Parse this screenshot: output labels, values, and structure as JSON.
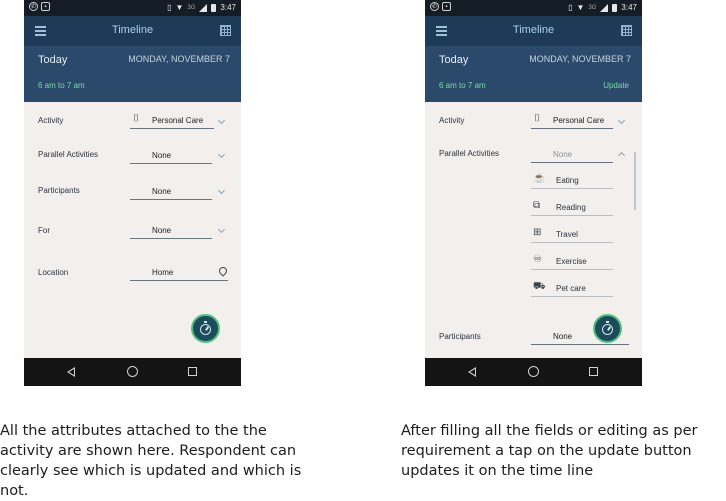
{
  "status_bar": {
    "time": "3:47",
    "network": "3G"
  },
  "left_screen": {
    "app_title": "Timeline",
    "today_label": "Today",
    "date": "MONDAY, NOVEMBER 7",
    "time_range": "6 am to 7 am",
    "rows": [
      {
        "label": "Activity",
        "value": "Personal Care"
      },
      {
        "label": "Parallel Activities",
        "value": "None"
      },
      {
        "label": "Participants",
        "value": "None"
      },
      {
        "label": "For",
        "value": "None"
      },
      {
        "label": "Location",
        "value": "Home"
      }
    ]
  },
  "right_screen": {
    "app_title": "Timeline",
    "today_label": "Today",
    "date": "MONDAY, NOVEMBER 7",
    "time_range": "6 am to 7 am",
    "update_label": "Update",
    "activity_label": "Activity",
    "activity_value": "Personal Care",
    "parallel_label": "Parallel Activities",
    "parallel_value": "None",
    "suggestions": [
      "Eating",
      "Reading",
      "Travel",
      "Exercise",
      "Pet care"
    ],
    "participants_label": "Participants",
    "participants_value": "None"
  },
  "icons": {
    "menu": "menu-icon",
    "calendar": "calendar-icon",
    "activity": "personal-care-icon",
    "location": "location-pin-icon",
    "fab": "stopwatch-icon",
    "suggestion_icons": [
      "eating-icon",
      "reading-icon",
      "travel-icon",
      "exercise-icon",
      "pet-care-icon"
    ]
  },
  "colors": {
    "app_bar": "#1d3a57",
    "day_band": "#2b4a6b",
    "accent_green": "#79d8a6",
    "fab_ring": "#4fc27f",
    "screen_bg": "#f3efec"
  },
  "captions": {
    "left": "All the attributes attached to the the activity are shown here. Respondent can clearly see which is updated and which is not.",
    "right": "After filling all the fields or editing as per requirement a tap on the update button updates it on the time line"
  }
}
